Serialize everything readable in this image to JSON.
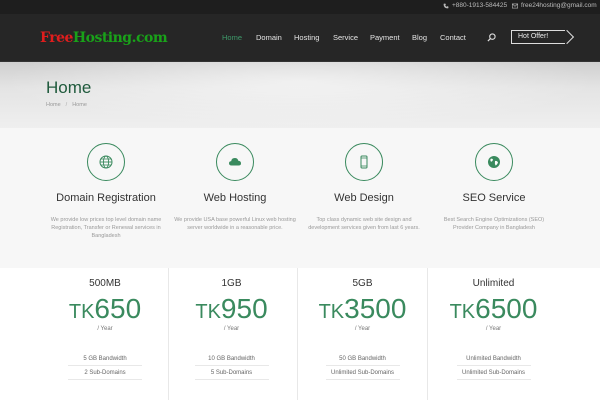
{
  "topbar": {
    "phone": "+880-1913-584425",
    "email": "free24hosting@gmail.com"
  },
  "header": {
    "logo_part1": "Free",
    "logo_part2": "Hosting.com",
    "nav": [
      "Home",
      "Domain",
      "Hosting",
      "Service",
      "Payment",
      "Blog",
      "Contact"
    ],
    "active_nav": "Home",
    "hot_offer_label": "Hot Offer!"
  },
  "page": {
    "title": "Home",
    "breadcrumb": [
      "Home",
      "Home"
    ],
    "breadcrumb_sep": "/"
  },
  "services": [
    {
      "title": "Domain Registration",
      "icon": "globe-grid-icon",
      "desc": "We provide low prices top level domain name Registration, Transfer or Renewal services in Bangladesh"
    },
    {
      "title": "Web Hosting",
      "icon": "cloud-icon",
      "desc": "We provide USA base powerful Linux web hosting server worldwide in a reasonable price."
    },
    {
      "title": "Web Design",
      "icon": "mobile-icon",
      "desc": "Top class dynamic web site design and development services given from last 6 years."
    },
    {
      "title": "SEO Service",
      "icon": "earth-icon",
      "desc": "Best Search Engine Optimizations (SEO) Provider Company in Bangladesh"
    }
  ],
  "plans": [
    {
      "name": "500MB",
      "currency": "TK",
      "price": "650",
      "period": "/ Year",
      "features": [
        "5 GB Bandwidth",
        "2 Sub-Domains"
      ]
    },
    {
      "name": "1GB",
      "currency": "TK",
      "price": "950",
      "period": "/ Year",
      "features": [
        "10 GB Bandwidth",
        "5 Sub-Domains"
      ]
    },
    {
      "name": "5GB",
      "currency": "TK",
      "price": "3500",
      "period": "/ Year",
      "features": [
        "50 GB Bandwidth",
        "Unlimited Sub-Domains"
      ]
    },
    {
      "name": "Unlimited",
      "currency": "TK",
      "price": "6500",
      "period": "/ Year",
      "features": [
        "Unlimited Bandwidth",
        "Unlimited Sub-Domains"
      ]
    }
  ],
  "colors": {
    "accent": "#3a8a5e",
    "title_green": "#1f5a3c",
    "header_bg": "#262626",
    "topbar_bg": "#1e1e1e"
  }
}
